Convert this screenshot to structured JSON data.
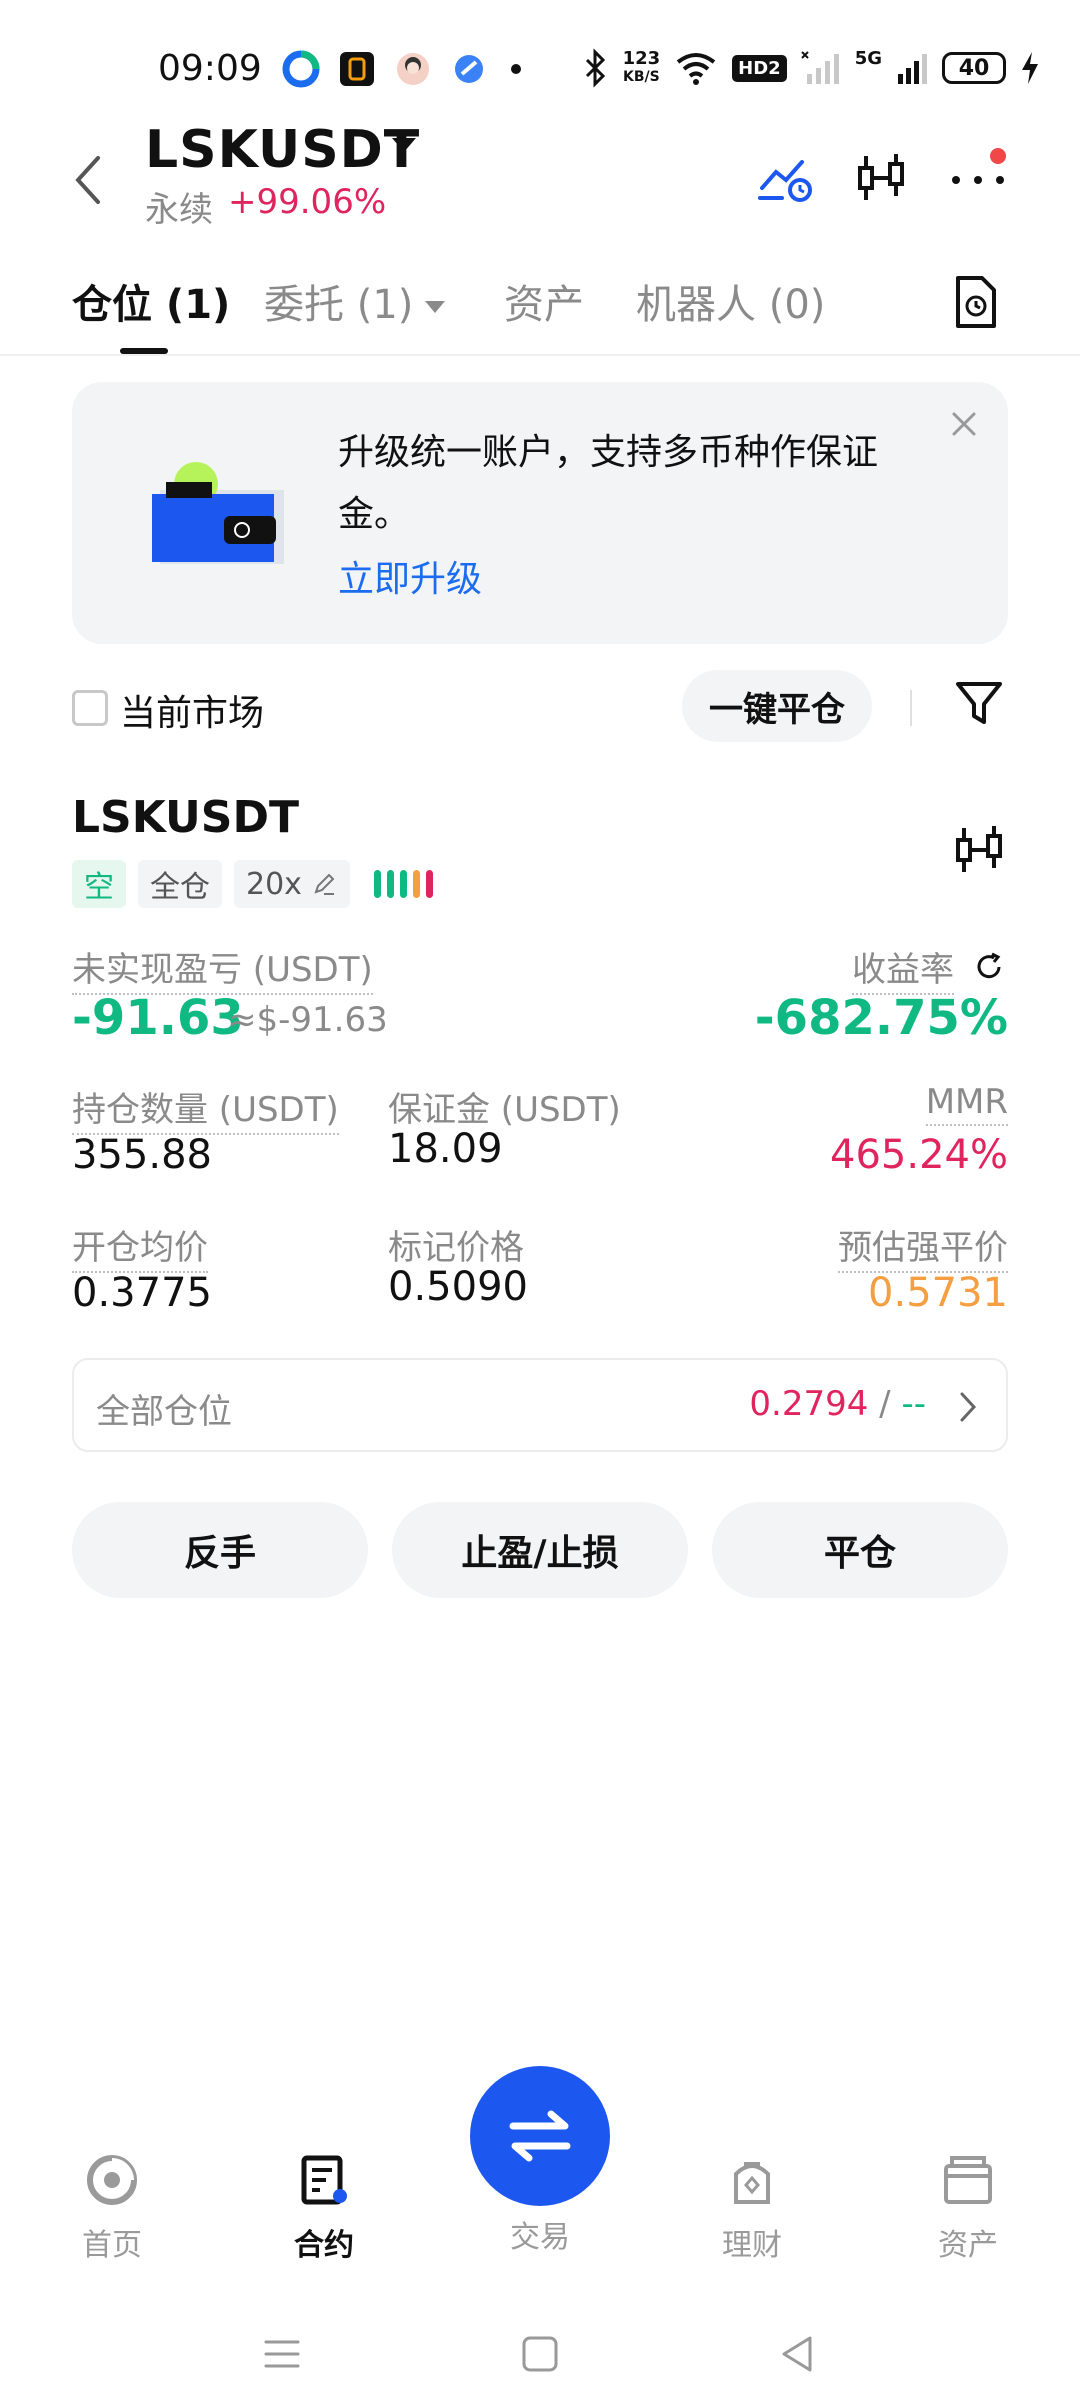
{
  "status_bar": {
    "time": "09:09",
    "speed_value": "123",
    "speed_unit": "KB/S",
    "hd_badge": "HD2",
    "net_badge": "5G",
    "battery": "40"
  },
  "header": {
    "symbol": "LSKUSDT",
    "contract_type": "永续",
    "change_pct": "+99.06%"
  },
  "tabs": [
    {
      "label": "仓位 (1)"
    },
    {
      "label": "委托 (1)"
    },
    {
      "label": "资产"
    },
    {
      "label": "机器人 (0)"
    }
  ],
  "banner": {
    "text": "升级统一账户，支持多币种作保证金。",
    "link": "立即升级"
  },
  "filter": {
    "current_market_label": "当前市场",
    "close_all_label": "一键平仓"
  },
  "position": {
    "symbol": "LSKUSDT",
    "tags": {
      "side": "空",
      "margin_mode": "全仓",
      "leverage": "20x"
    },
    "risk_colors": [
      "#10b981",
      "#10b981",
      "#10b981",
      "#f59e42",
      "#e0245e"
    ],
    "unrealized_pnl_label": "未实现盈亏 (USDT)",
    "unrealized_pnl": "-91.63",
    "unrealized_pnl_usd": "≈$-91.63",
    "roi_label": "收益率",
    "roi": "-682.75%",
    "size_label": "持仓数量 (USDT)",
    "size": "355.88",
    "margin_label": "保证金 (USDT)",
    "margin": "18.09",
    "mmr_label": "MMR",
    "mmr": "465.24%",
    "entry_label": "开仓均价",
    "entry": "0.3775",
    "mark_label": "标记价格",
    "mark": "0.5090",
    "liq_label": "预估强平价",
    "liq": "0.5731"
  },
  "all_positions": {
    "label": "全部仓位",
    "value": "0.2794",
    "sep": " / ",
    "tp": "--"
  },
  "actions": {
    "reverse": "反手",
    "tp_sl": "止盈/止损",
    "close": "平仓"
  },
  "bottom_nav": {
    "home": "首页",
    "futures": "合约",
    "trade": "交易",
    "earn": "理财",
    "assets": "资产"
  }
}
